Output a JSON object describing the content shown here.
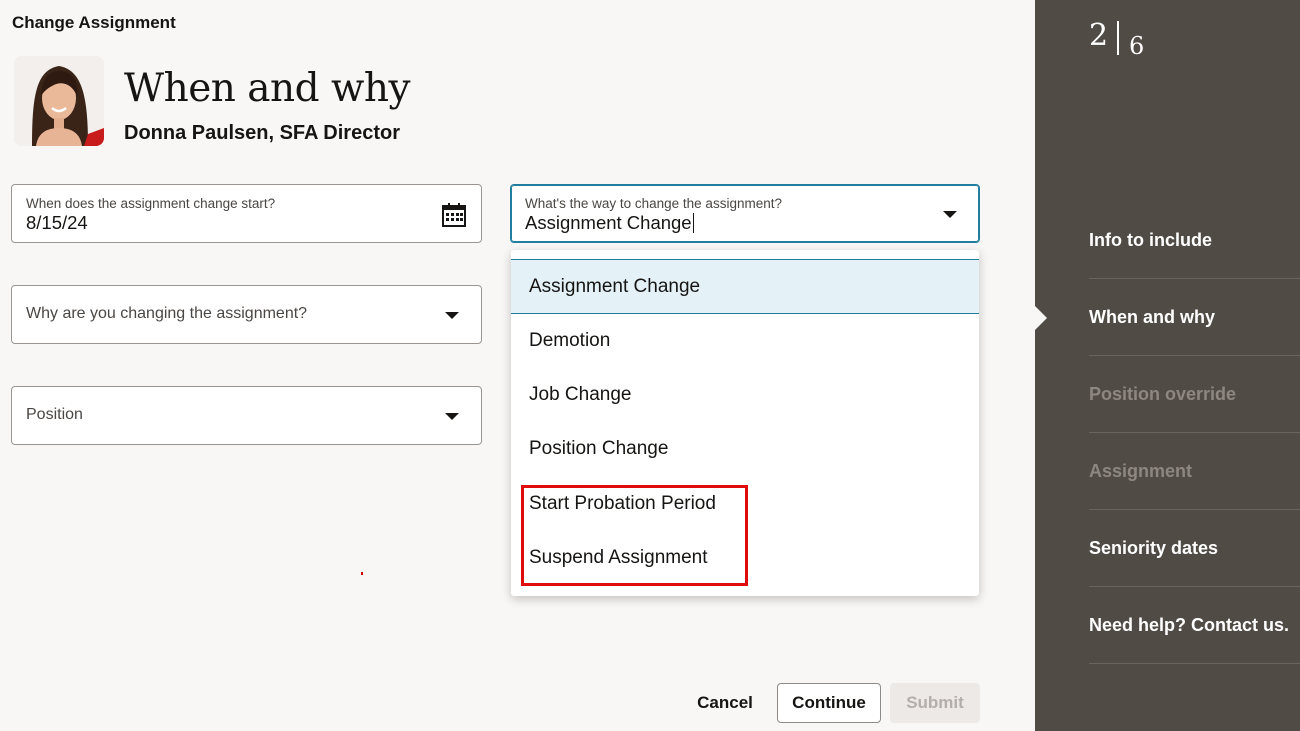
{
  "header": {
    "title": "Change Assignment"
  },
  "person": {
    "heading": "When and why",
    "name_role": "Donna Paulsen, SFA Director"
  },
  "form": {
    "start_date": {
      "label": "When does the assignment change start?",
      "value": "8/15/24"
    },
    "action": {
      "label": "What's the way to change the assignment?",
      "value": "Assignment Change"
    },
    "reason": {
      "placeholder": "Why are you changing the assignment?"
    },
    "position": {
      "placeholder": "Position"
    }
  },
  "dropdown": {
    "options": [
      "Assignment Change",
      "Demotion",
      "Job Change",
      "Position Change",
      "Start Probation Period",
      "Suspend Assignment"
    ],
    "selected": "Assignment Change"
  },
  "footer": {
    "cancel": "Cancel",
    "continue": "Continue",
    "submit": "Submit"
  },
  "sidebar": {
    "step_current": "2",
    "step_total": "6",
    "items": [
      {
        "label": "Info to include",
        "state": "enabled"
      },
      {
        "label": "When and why",
        "state": "current"
      },
      {
        "label": "Position override",
        "state": "disabled"
      },
      {
        "label": "Assignment",
        "state": "disabled"
      },
      {
        "label": "Seniority dates",
        "state": "enabled"
      },
      {
        "label": "Need help? Contact us.",
        "state": "enabled"
      }
    ]
  },
  "colors": {
    "sidebar_bg": "#514b45",
    "accent": "#227e9e",
    "highlight": "#e00b0b",
    "page_bg": "#f9f7f5"
  }
}
